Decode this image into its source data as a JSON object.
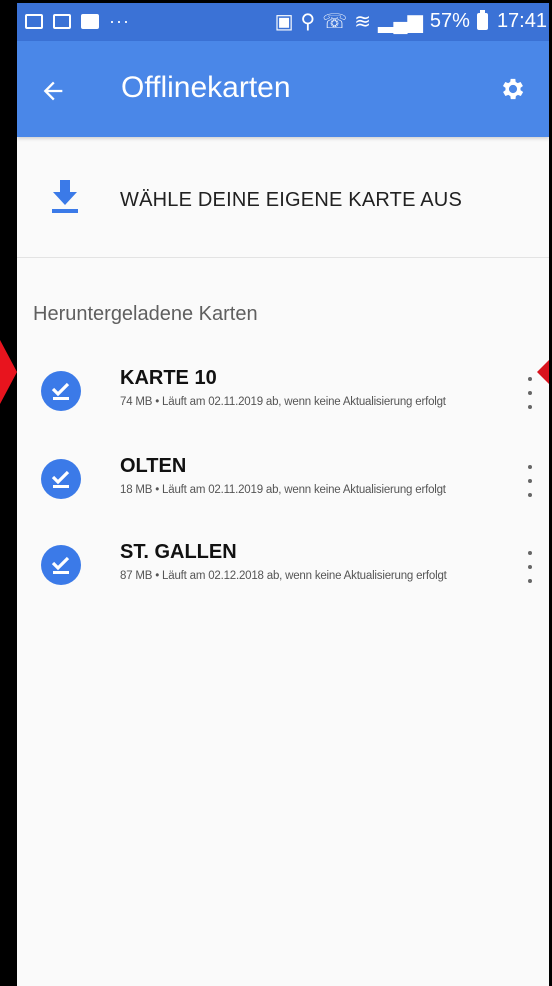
{
  "status_bar": {
    "left_dots": "···",
    "battery_percent": "57%",
    "time": "17:41"
  },
  "app_bar": {
    "back_icon": "arrow-left-icon",
    "title": "Offlinekarten",
    "settings_icon": "gear-icon"
  },
  "choose_map": {
    "icon": "download-icon",
    "label": "WÄHLE DEINE EIGENE KARTE AUS"
  },
  "downloaded": {
    "section_title": "Heruntergeladene Karten",
    "items": [
      {
        "name": "KARTE 10",
        "subtitle": "74 MB • Läuft am 02.11.2019 ab, wenn keine Aktualisierung erfolgt"
      },
      {
        "name": "OLTEN",
        "subtitle": "18 MB • Läuft am 02.11.2019 ab, wenn keine Aktualisierung erfolgt"
      },
      {
        "name": "ST. GALLEN",
        "subtitle": "87 MB • Läuft am 02.12.2018 ab, wenn keine Aktualisierung erfolgt"
      }
    ]
  },
  "colors": {
    "status_bar": "#3b72d6",
    "app_bar": "#4a87e8",
    "accent": "#3b7ae8",
    "annotation_arrow": "#e8141e"
  }
}
